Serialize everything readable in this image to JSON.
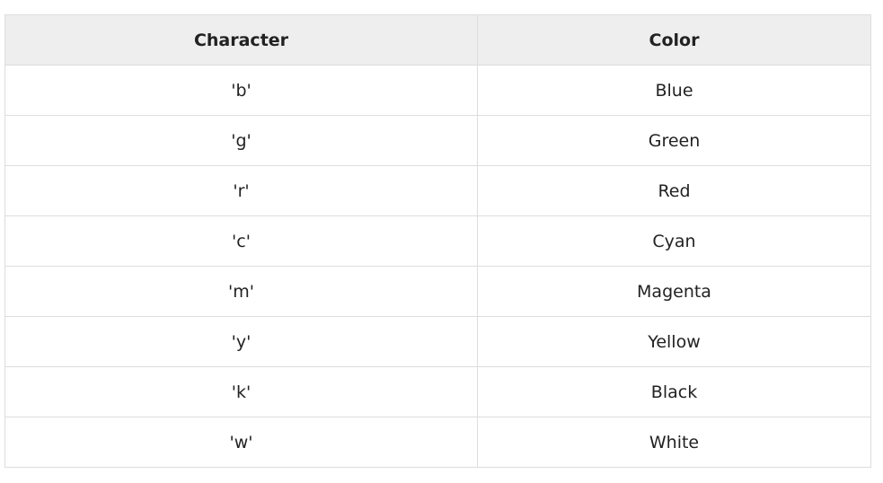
{
  "table": {
    "headers": [
      "Character",
      "Color"
    ],
    "rows": [
      [
        "'b'",
        "Blue"
      ],
      [
        "'g'",
        "Green"
      ],
      [
        "'r'",
        "Red"
      ],
      [
        "'c'",
        "Cyan"
      ],
      [
        "'m'",
        "Magenta"
      ],
      [
        "'y'",
        "Yellow"
      ],
      [
        "'k'",
        "Black"
      ],
      [
        "'w'",
        "White"
      ]
    ]
  }
}
